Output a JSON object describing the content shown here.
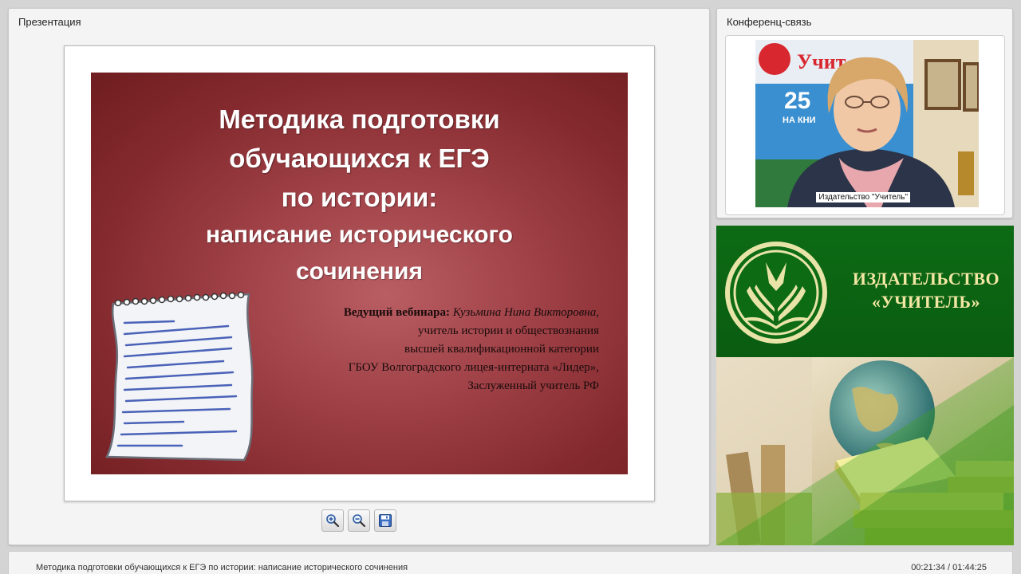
{
  "presentation": {
    "panel_title": "Презентация",
    "slide": {
      "title_lines": [
        "Методика подготовки",
        "обучающихся к ЕГЭ",
        "по истории:",
        "написание исторического",
        "сочинения"
      ],
      "host_label": "Ведущий вебинара:",
      "host_name": "Кузьмина Нина Викторовна,",
      "host_lines": [
        "учитель истории и обществознания",
        "высшей квалификационной категории",
        "ГБОУ Волгоградского лицея-интерната «Лидер»,",
        "Заслуженный учитель РФ"
      ]
    },
    "toolbar": {
      "zoom_in_icon": "zoom-in-icon",
      "zoom_out_icon": "zoom-out-icon",
      "save_icon": "save-icon"
    }
  },
  "conference": {
    "panel_title": "Конференц-связь",
    "video_label": "Издательство \"Учитель\""
  },
  "banner": {
    "line1": "ИЗДАТЕЛЬСТВО",
    "line2": "«УЧИТЕЛЬ»"
  },
  "footer": {
    "title": "Методика подготовки обучающихся к ЕГЭ по истории: написание исторического сочинения",
    "time": "00:21:34 / 01:44:25"
  },
  "colors": {
    "slide_bg": "#8f3338",
    "banner_green": "#0d6b14",
    "banner_text": "#f3e7a4"
  }
}
